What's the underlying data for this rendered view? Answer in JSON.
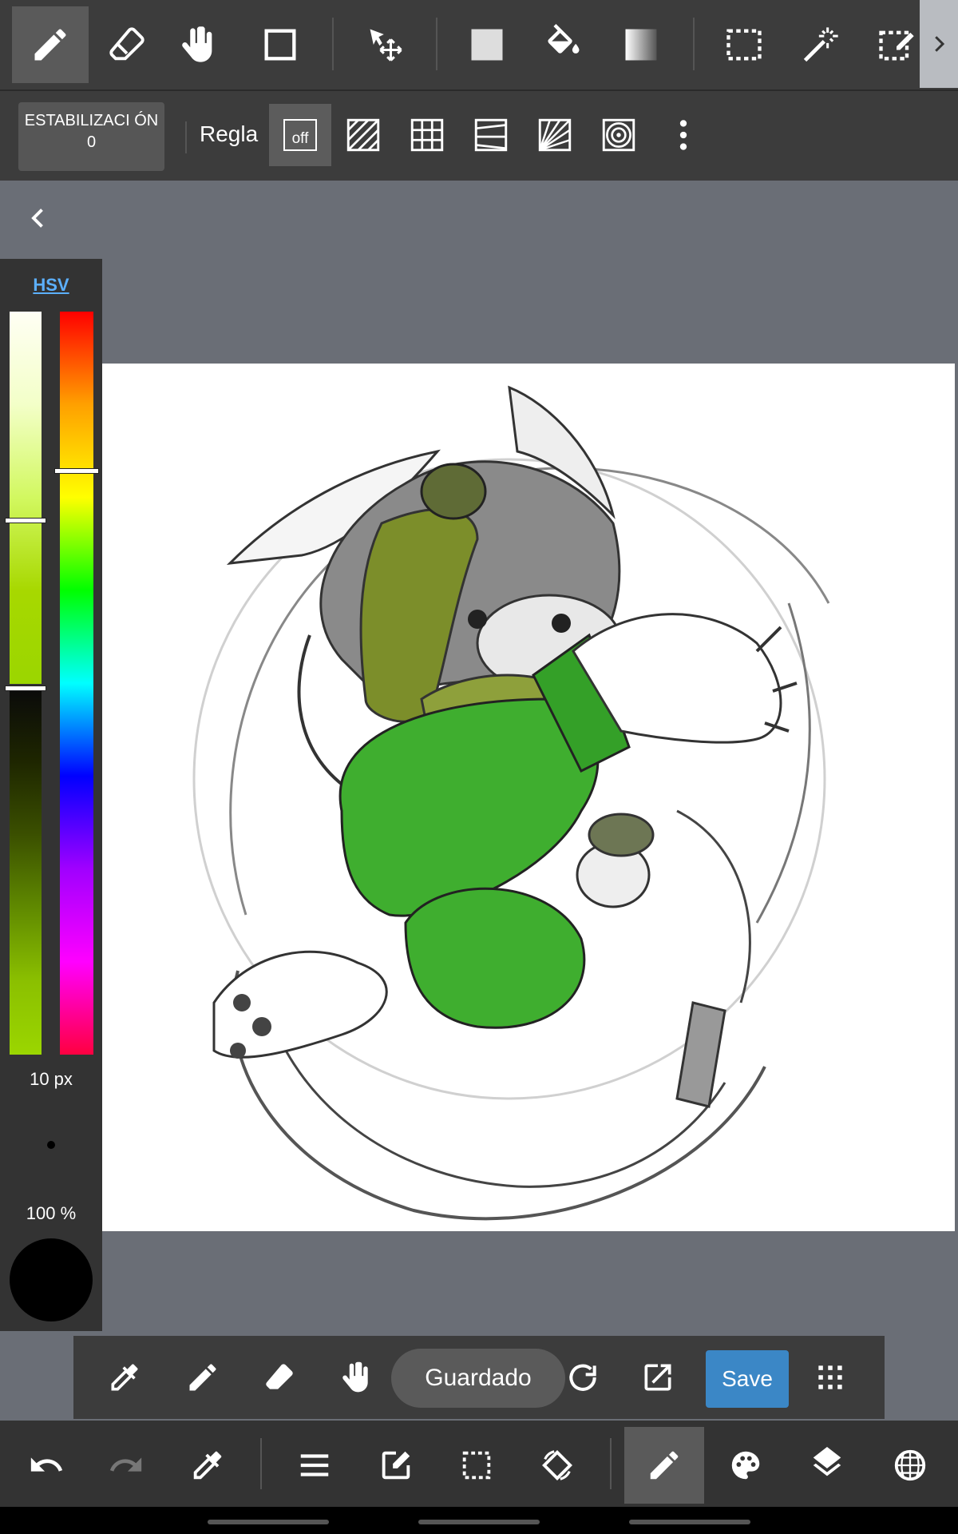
{
  "top_tools": [
    {
      "name": "pen-tool"
    },
    {
      "name": "eraser-tool"
    },
    {
      "name": "hand-tool"
    },
    {
      "name": "shape-tool"
    },
    {
      "name": "move-tool"
    },
    {
      "name": "fill-rect-tool"
    },
    {
      "name": "bucket-tool"
    },
    {
      "name": "gradient-tool"
    },
    {
      "name": "select-tool"
    },
    {
      "name": "magic-wand-tool"
    },
    {
      "name": "select-pen-tool"
    }
  ],
  "subbar": {
    "stabilization_label": "ESTABILIZACI ÓN",
    "stabilization_value": "0",
    "ruler_label": "Regla",
    "ruler_off_label": "off"
  },
  "color_panel": {
    "mode_label": "HSV",
    "brush_size": "10 px",
    "opacity": "100 %",
    "current_color": "#000000",
    "accent_green": "#9bd600"
  },
  "bottom_bar": {
    "toast": "Guardado",
    "save_label": "Save"
  },
  "colors": {
    "toolbar_bg": "#3c3c3c",
    "workspace_bg": "#6a6e76",
    "save_button": "#3b87c6"
  }
}
